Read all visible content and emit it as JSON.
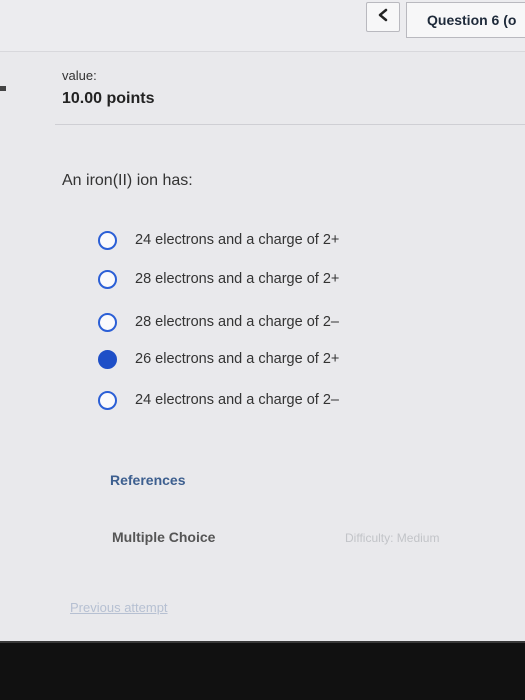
{
  "header": {
    "back_icon": "chevron-left-icon",
    "back_glyph": "<",
    "question_nav_label": "Question 6 (o"
  },
  "score": {
    "value_label": "value:",
    "points": "10.00 points"
  },
  "question": {
    "prompt": "An iron(II) ion has:",
    "selected_index": 3,
    "options": [
      {
        "label": "24 electrons and a charge of 2+",
        "selected": false
      },
      {
        "label": "28 electrons and a charge of 2+",
        "selected": false
      },
      {
        "label": "28 electrons and a charge of 2–",
        "selected": false
      },
      {
        "label": "26 electrons and a charge of 2+",
        "selected": true
      },
      {
        "label": "24 electrons and a charge of 2–",
        "selected": false
      }
    ]
  },
  "footer": {
    "references": "References",
    "question_type": "Multiple Choice",
    "difficulty": "Difficulty: Medium",
    "previous_attempt": "Previous attempt"
  },
  "colors": {
    "radio_accent": "#2b5fd6",
    "link": "#3d5f8f",
    "background": "#e9e9ec"
  }
}
